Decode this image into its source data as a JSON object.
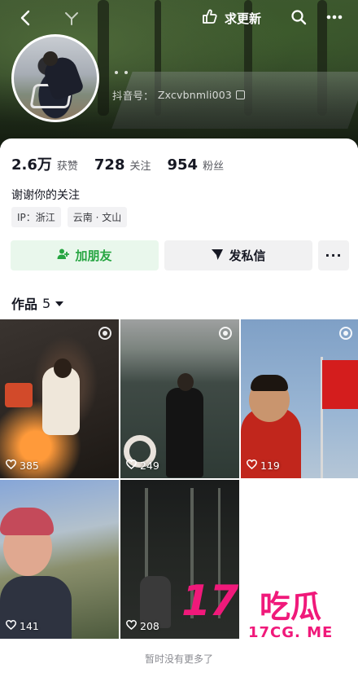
{
  "header": {
    "update_label": "求更新",
    "douyin_id_label": "抖音号：",
    "douyin_id": "Zxcvbnmli003"
  },
  "stats": {
    "likes_num": "2.6万",
    "likes_label": "获赞",
    "following_num": "728",
    "following_label": "关注",
    "followers_num": "954",
    "followers_label": "粉丝"
  },
  "bio": "谢谢你的关注",
  "tags": [
    "IP：浙江",
    "云南 · 文山"
  ],
  "actions": {
    "follow_label": "加朋友",
    "message_label": "发私信",
    "more_label": "···"
  },
  "works": {
    "tab_label": "作品",
    "count": "5"
  },
  "grid": [
    {
      "likes": "385",
      "pinned": true
    },
    {
      "likes": "249",
      "pinned": true
    },
    {
      "likes": "119",
      "pinned": true
    },
    {
      "likes": "141",
      "pinned": false
    },
    {
      "likes": "208",
      "pinned": false
    }
  ],
  "footer": "暂时没有更多了",
  "watermark": {
    "number": "17",
    "text": "吃瓜",
    "site": "17CG. ME"
  },
  "colors": {
    "follow_green": "#26a541",
    "watermark_pink": "#f0197a"
  },
  "icons": [
    "back-icon",
    "logo-icon",
    "hand-icon",
    "search-icon",
    "more-icon",
    "copy-icon",
    "add-friend-icon",
    "send-icon",
    "heart-icon",
    "pin-icon"
  ]
}
